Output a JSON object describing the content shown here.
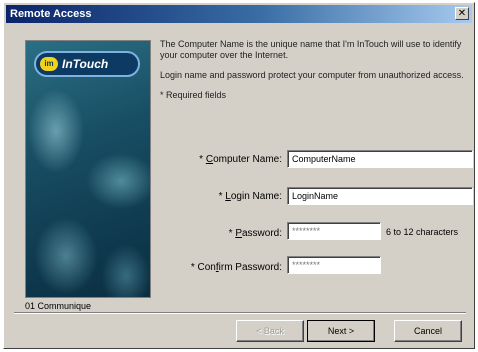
{
  "window": {
    "title": "Remote Access",
    "close_icon": "close-icon"
  },
  "side_panel": {
    "logo_badge": "im",
    "logo_text": "InTouch"
  },
  "intro": {
    "line1": "The Computer Name is the unique name that I'm InTouch will use to identify your computer over the Internet.",
    "line2": "Login name and password protect your computer from unauthorized access.",
    "line3": "* Required fields"
  },
  "form": {
    "computer_name": {
      "prefix": "* ",
      "access": "C",
      "rest": "omputer Name:",
      "value": "ComputerName"
    },
    "login_name": {
      "prefix": "* ",
      "access": "L",
      "rest": "ogin Name:",
      "value": "LoginName"
    },
    "password": {
      "prefix": "* ",
      "access": "P",
      "rest": "assword:",
      "value": "********",
      "hint": "6 to 12 characters"
    },
    "confirm_password": {
      "prefix": "* Con",
      "access": "f",
      "rest": "irm Password:",
      "value": "********"
    }
  },
  "status": {
    "text": "01 Communique"
  },
  "buttons": {
    "back": "< Back",
    "next": "Next >",
    "cancel": "Cancel"
  }
}
